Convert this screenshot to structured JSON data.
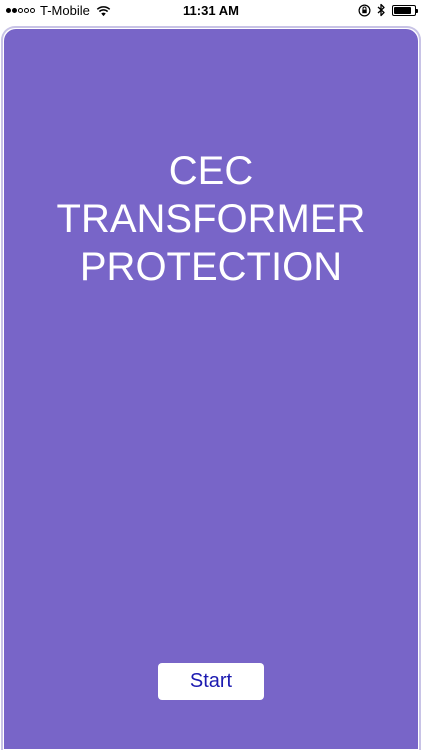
{
  "status_bar": {
    "carrier": "T-Mobile",
    "time": "11:31 AM",
    "signal_bars_filled": 2,
    "signal_bars_total": 5,
    "battery_level": 0.85
  },
  "main": {
    "title_lines": [
      "CEC",
      "TRANSFORMER",
      "PROTECTION"
    ],
    "start_label": "Start"
  },
  "colors": {
    "card_background": "#7865c8",
    "button_text": "#1c1ab0",
    "title_text": "#ffffff"
  },
  "icons": [
    "wifi-icon",
    "rotation-lock-icon",
    "bluetooth-icon",
    "battery-icon"
  ]
}
